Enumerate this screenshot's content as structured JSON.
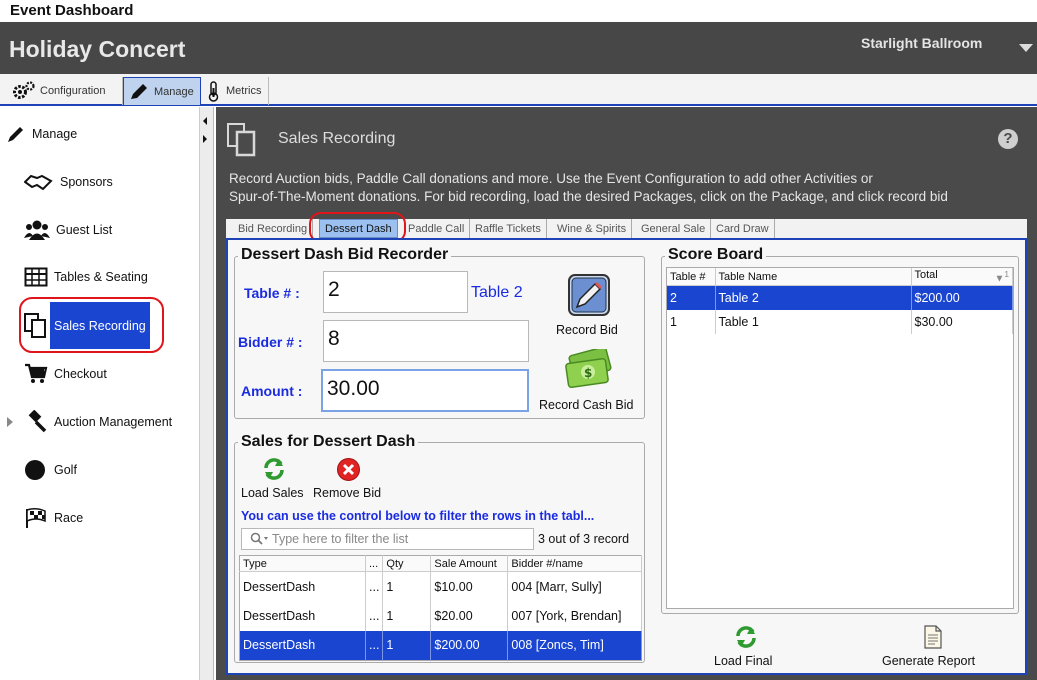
{
  "window": {
    "title": "Event Dashboard"
  },
  "header": {
    "event_title": "Holiday Concert",
    "venue": "Starlight Ballroom"
  },
  "top_tabs": [
    {
      "label": "Configuration"
    },
    {
      "label": "Manage"
    },
    {
      "label": "Metrics"
    }
  ],
  "sidebar": {
    "items": [
      {
        "label": "Manage"
      },
      {
        "label": "Sponsors"
      },
      {
        "label": "Guest List"
      },
      {
        "label": "Tables & Seating"
      },
      {
        "label": "Sales Recording"
      },
      {
        "label": "Checkout"
      },
      {
        "label": "Auction Management"
      },
      {
        "label": "Golf"
      },
      {
        "label": "Race"
      }
    ]
  },
  "main": {
    "title": "Sales Recording",
    "description_line1": "Record Auction bids, Paddle Call donations and more. Use the Event Configuration to add other Activities or",
    "description_line2": "Spur-of-The-Moment donations. For bid recording, load the desired Packages, click on the Package, and click record bid",
    "sub_tabs": [
      "Bid Recording",
      "Dessert Dash",
      "Paddle Call",
      "Raffle Tickets",
      "Wine & Spirits",
      "General Sale",
      "Card Draw"
    ]
  },
  "recorder": {
    "title": "Dessert Dash Bid Recorder",
    "table_label": "Table # :",
    "table_value": "2",
    "table_name": "Table 2",
    "bidder_label": "Bidder # :",
    "bidder_value": "8",
    "amount_label": "Amount :",
    "amount_value": "30.00",
    "record_bid": "Record Bid",
    "record_cash_bid": "Record Cash Bid"
  },
  "sales": {
    "title": "Sales for Dessert Dash",
    "load_sales": "Load Sales",
    "remove_bid": "Remove Bid",
    "filter_note": "You can use the control below to filter the rows in the tabl...",
    "filter_placeholder": "Type here to filter the list",
    "record_count": "3 out of 3 record",
    "columns": [
      "Type",
      "...",
      "Qty",
      "Sale Amount",
      "Bidder #/name"
    ],
    "rows": [
      {
        "type": "DessertDash",
        "more": "...",
        "qty": "1",
        "amount": "$10.00",
        "bidder": "004 [Marr, Sully]"
      },
      {
        "type": "DessertDash",
        "more": "...",
        "qty": "1",
        "amount": "$20.00",
        "bidder": "007 [York, Brendan]"
      },
      {
        "type": "DessertDash",
        "more": "...",
        "qty": "1",
        "amount": "$200.00",
        "bidder": "008 [Zoncs, Tim]"
      }
    ]
  },
  "scoreboard": {
    "title": "Score Board",
    "columns": [
      "Table #",
      "Table Name",
      "Total"
    ],
    "sort_indicator": "1",
    "rows": [
      {
        "table": "2",
        "name": "Table 2",
        "total": "$200.00"
      },
      {
        "table": "1",
        "name": "Table 1",
        "total": "$30.00"
      }
    ],
    "load_final": "Load Final",
    "generate_report": "Generate Report"
  },
  "colors": {
    "accent": "#1a45d0",
    "header_bg": "#474747",
    "label_blue": "#1a2be0",
    "highlight_red": "#e0141b"
  }
}
